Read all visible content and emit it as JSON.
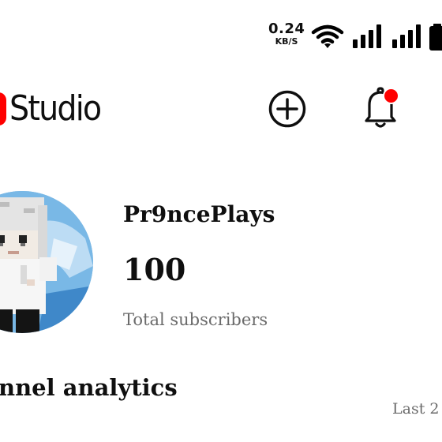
{
  "status_bar": {
    "speed_value": "0.24",
    "speed_unit": "KB/S",
    "icons": [
      "wifi-icon",
      "signal-icon",
      "signal-icon",
      "battery-icon"
    ]
  },
  "header": {
    "app_name": "Studio",
    "brand_color": "#ff0000",
    "actions": [
      "create-icon",
      "notifications-icon"
    ],
    "has_unread_notifications": true
  },
  "channel": {
    "name": "Pr9ncePlays",
    "subscriber_count": "100",
    "subscriber_label": "Total subscribers"
  },
  "analytics": {
    "title": "nnel analytics",
    "range_label": "Last 2"
  }
}
